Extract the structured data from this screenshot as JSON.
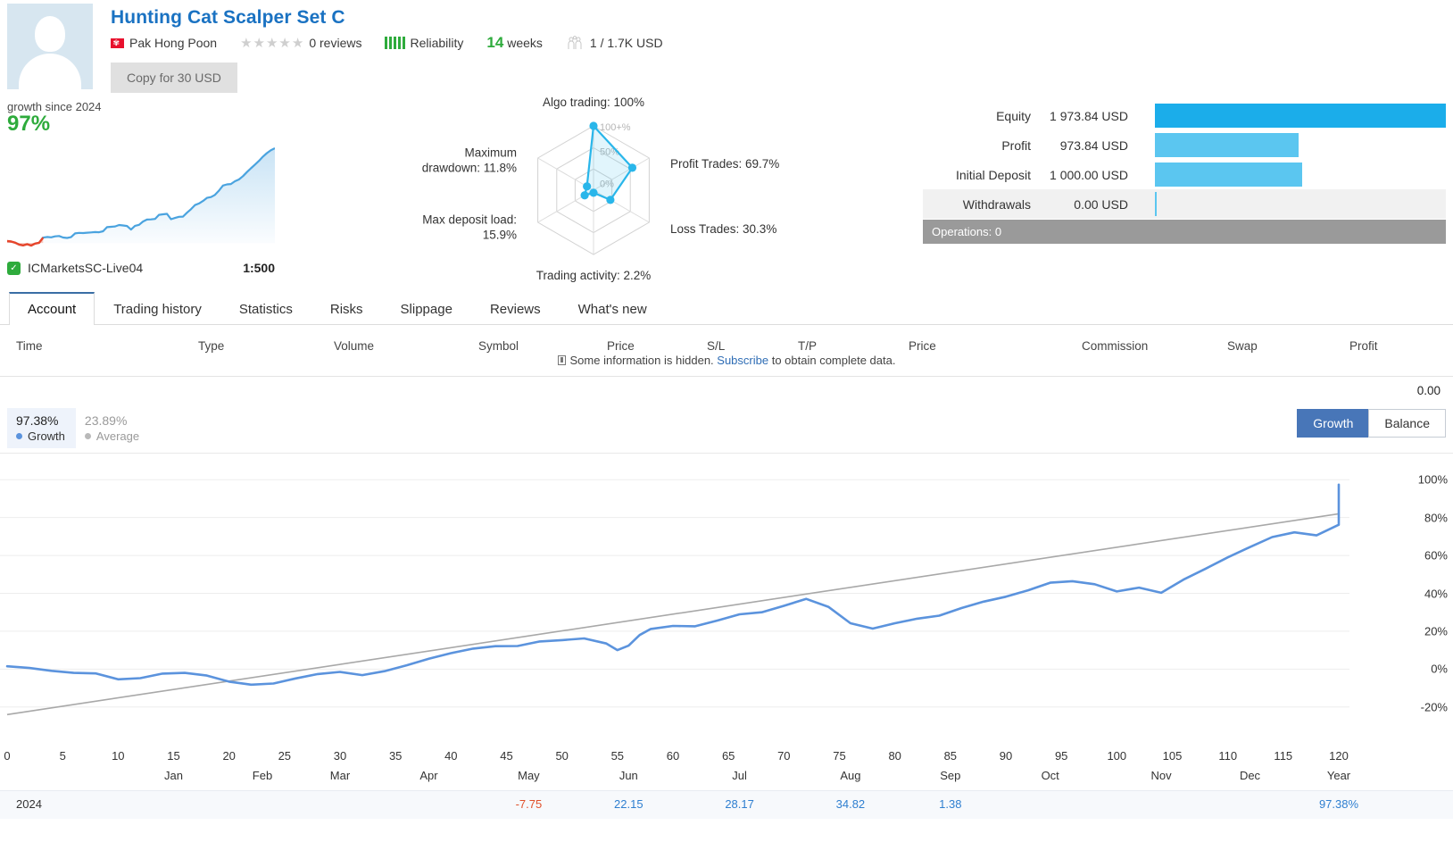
{
  "header": {
    "title": "Hunting Cat Scalper Set C",
    "author": "Pak Hong Poon",
    "flag_icon": "hong-kong-flag",
    "stars": "★★★★★",
    "reviews": "0 reviews",
    "reliability_label": "Reliability",
    "reliability_bars": 5,
    "weeks_value": "14",
    "weeks_label": "weeks",
    "subscribers": "1 / 1.7K USD",
    "copy_button": "Copy for 30 USD"
  },
  "summary": {
    "growth_caption": "growth since 2024",
    "growth_value": "97%",
    "broker": "ICMarketsSC-Live04",
    "leverage": "1:500",
    "sparkline": {
      "values": [
        2,
        1.5,
        0.3,
        -1.6,
        -2.4,
        -1.2,
        -2.6,
        -0.6,
        0.2,
        5.5,
        6.2,
        5.8,
        6.8,
        7.2,
        5.6,
        5.2,
        6.0,
        9.8,
        10.4,
        10.2,
        10.6,
        10.8,
        11.2,
        11.0,
        12.0,
        16.2,
        16.6,
        17.0,
        18.4,
        18.0,
        17.4,
        13.8,
        17.6,
        18.6,
        22.0,
        24.0,
        24.2,
        24.6,
        28.8,
        29.4,
        29.8,
        24.4,
        25.6,
        26.8,
        27.0,
        31.0,
        34.6,
        38.8,
        40.4,
        43.0,
        46.2,
        47.0,
        49.2,
        53.6,
        58.8,
        60.0,
        60.4,
        63.2,
        65.0,
        68.4,
        72.6,
        76.4,
        80.2,
        84.0,
        88.4,
        92.0,
        95.0,
        97.0
      ],
      "negative_until_index": 9
    }
  },
  "radar": {
    "axes": [
      {
        "name": "Algo trading",
        "label": "Algo trading: 100%",
        "value": 100
      },
      {
        "name": "Profit Trades",
        "label": "Profit Trades: 69.7%",
        "value": 69.7
      },
      {
        "name": "Loss Trades",
        "label": "Loss Trades: 30.3%",
        "value": 30.3
      },
      {
        "name": "Trading activity",
        "label": "Trading activity: 2.2%",
        "value": 2.2
      },
      {
        "name": "Max deposit load",
        "label": "Max deposit load: 15.9%",
        "value": 15.9
      },
      {
        "name": "Maximum drawdown",
        "label": "Maximum drawdown: 11.8%",
        "value": 11.8
      }
    ],
    "ring_labels": [
      "100+%",
      "50%",
      "0%"
    ]
  },
  "equity": {
    "rows": [
      {
        "label": "Equity",
        "value": "1 973.84 USD",
        "pct": 100,
        "color": "#1badea"
      },
      {
        "label": "Profit",
        "value": "973.84 USD",
        "pct": 49.3,
        "color": "#5bc6f0"
      },
      {
        "label": "Initial Deposit",
        "value": "1 000.00 USD",
        "pct": 50.6,
        "color": "#5bc6f0"
      },
      {
        "label": "Withdrawals",
        "value": "0.00 USD",
        "pct": 0,
        "color": "#5bc6f0"
      }
    ],
    "operations": "Operations: 0"
  },
  "tabs": [
    {
      "label": "Account",
      "active": true
    },
    {
      "label": "Trading history",
      "active": false
    },
    {
      "label": "Statistics",
      "active": false
    },
    {
      "label": "Risks",
      "active": false
    },
    {
      "label": "Slippage",
      "active": false
    },
    {
      "label": "Reviews",
      "active": false
    },
    {
      "label": "What's new",
      "active": false
    }
  ],
  "table": {
    "columns": [
      "Time",
      "Type",
      "Volume",
      "Symbol",
      "Price",
      "S/L",
      "T/P",
      "Price",
      "Commission",
      "Swap",
      "Profit"
    ],
    "hidden_note_prefix": "Some information is hidden. ",
    "hidden_note_link": "Subscribe",
    "hidden_note_suffix": " to obtain complete data.",
    "total": "0.00"
  },
  "chart_toolbar": {
    "growth_value": "97.38%",
    "growth_name": "Growth",
    "average_value": "23.89%",
    "average_name": "Average",
    "btn_growth": "Growth",
    "btn_balance": "Balance",
    "active_button": "Growth"
  },
  "chart_data": {
    "type": "line",
    "title": "Growth",
    "xlabel": "",
    "ylabel": "",
    "xlim": [
      0,
      120
    ],
    "ylim": [
      -30,
      110
    ],
    "grid": true,
    "legend_position": "top-left",
    "x_ticks": [
      0,
      5,
      10,
      15,
      20,
      25,
      30,
      35,
      40,
      45,
      50,
      55,
      60,
      65,
      70,
      75,
      80,
      85,
      90,
      95,
      100,
      105,
      110,
      115,
      120
    ],
    "month_ticks": [
      {
        "x": 15,
        "label": "Jan"
      },
      {
        "x": 23,
        "label": "Feb"
      },
      {
        "x": 30,
        "label": "Mar"
      },
      {
        "x": 38,
        "label": "Apr"
      },
      {
        "x": 47,
        "label": "May"
      },
      {
        "x": 56,
        "label": "Jun"
      },
      {
        "x": 66,
        "label": "Jul"
      },
      {
        "x": 76,
        "label": "Aug"
      },
      {
        "x": 85,
        "label": "Sep"
      },
      {
        "x": 94,
        "label": "Oct"
      },
      {
        "x": 104,
        "label": "Nov"
      },
      {
        "x": 112,
        "label": "Dec"
      },
      {
        "x": 120,
        "label": "Year"
      }
    ],
    "y_ticks": [
      -20,
      0,
      20,
      40,
      60,
      80,
      100
    ],
    "y_tick_labels": [
      "-20%",
      "0%",
      "20%",
      "40%",
      "60%",
      "80%",
      "100%"
    ],
    "series": [
      {
        "name": "Growth",
        "color": "#5b93dd",
        "x": [
          0,
          2,
          4,
          6,
          8,
          10,
          12,
          14,
          16,
          18,
          20,
          22,
          24,
          26,
          28,
          30,
          32,
          34,
          36,
          38,
          40,
          42,
          44,
          46,
          48,
          50,
          52,
          54,
          55,
          56,
          57,
          58,
          60,
          62,
          64,
          66,
          68,
          70,
          72,
          74,
          76,
          78,
          80,
          82,
          84,
          86,
          88,
          90,
          92,
          94,
          96,
          98,
          100,
          102,
          104,
          106,
          108,
          110,
          112,
          114,
          116,
          118,
          120
        ],
        "y": [
          1.5,
          0.6,
          -0.9,
          -2.0,
          -2.3,
          -5.4,
          -4.8,
          -2.4,
          -2.0,
          -3.4,
          -6.6,
          -8.2,
          -7.6,
          -4.9,
          -2.6,
          -1.5,
          -3.2,
          -1.1,
          2.0,
          5.5,
          8.4,
          10.8,
          12.1,
          12.2,
          14.6,
          15.3,
          16.2,
          13.5,
          10.0,
          12.4,
          18.0,
          21.2,
          22.8,
          22.6,
          25.6,
          28.9,
          30.0,
          33.4,
          37.1,
          32.9,
          24.2,
          21.4,
          24.2,
          26.6,
          28.2,
          32.2,
          35.6,
          38.2,
          41.6,
          45.6,
          46.4,
          44.8,
          41.0,
          43.0,
          40.3,
          47.2,
          53.0,
          59.0,
          64.4,
          69.7,
          72.2,
          70.6,
          76.2
        ],
        "y_tail": [
          80.4,
          86.2,
          90.4,
          88.8,
          87.6,
          92.0,
          95.2,
          97.38
        ]
      },
      {
        "name": "Average",
        "color": "#a8a8a8",
        "x": [
          0,
          120
        ],
        "y": [
          -24.0,
          82.0
        ]
      }
    ],
    "year_row": {
      "year": "2024",
      "cells": [
        {
          "x": 47,
          "value": "-7.75",
          "sign": "neg"
        },
        {
          "x": 56,
          "value": "22.15",
          "sign": "pos"
        },
        {
          "x": 66,
          "value": "28.17",
          "sign": "pos"
        },
        {
          "x": 76,
          "value": "34.82",
          "sign": "pos"
        },
        {
          "x": 85,
          "value": "1.38",
          "sign": "pos"
        },
        {
          "x": 120,
          "value": "97.38%",
          "sign": "pos"
        }
      ]
    }
  }
}
